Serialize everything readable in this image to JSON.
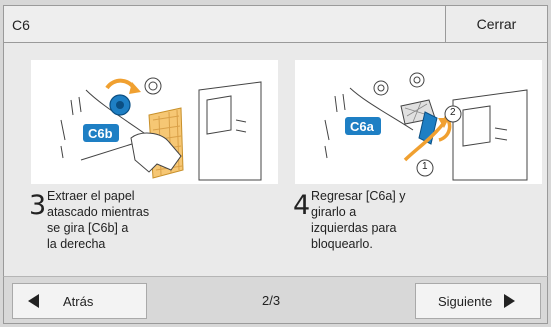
{
  "header": {
    "title": "C6",
    "close_label": "Cerrar"
  },
  "steps": [
    {
      "number": "3",
      "text": "Extraer el papel\natascado mientras\nse gira [C6b] a\nla derecha",
      "badge": "C6b"
    },
    {
      "number": "4",
      "text": "Regresar [C6a] y\ngirarlo a\nizquierdas para\nbloquearlo.",
      "badge": "C6a",
      "marker1": "1",
      "marker2": "2"
    }
  ],
  "footer": {
    "back_label": "Atrás",
    "page_indicator": "2/3",
    "next_label": "Siguiente"
  },
  "colors": {
    "accent_blue": "#1e7fc4",
    "orange": "#f0a030",
    "background": "#d7d7d7"
  }
}
